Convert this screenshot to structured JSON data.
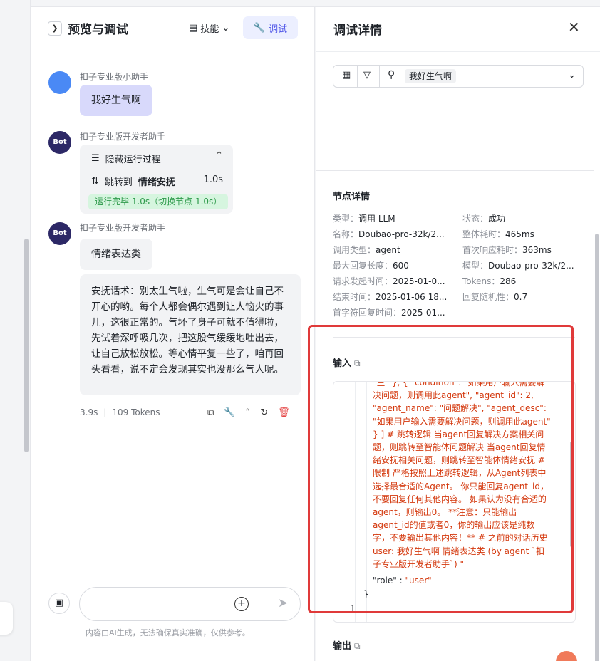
{
  "preview": {
    "title": "预览与调试",
    "skills_label": "技能",
    "debug_label": "调试",
    "user_name": "扣子专业版小助手",
    "user_message": "我好生气啊",
    "bot_name": "扣子专业版开发者助手",
    "bot_avatar_text": "Bot",
    "run_toggle": "隐藏运行过程",
    "jump_prefix": "跳转到",
    "jump_target": "情绪安抚",
    "jump_time": "1.0s",
    "run_done": "运行完毕 1.0s（切换节点 1.0s）",
    "bot_reply_1": "情绪表达类",
    "bot_reply_2": "安抚话术：别太生气啦，生气可是会让自己不开心的哟。每个人都会偶尔遇到让人恼火的事儿，这很正常的。气坏了身子可就不值得啦，先试着深呼吸几次，把这股气缓缓地吐出去，让自己放松放松。等心情平复一些了，咱再回头看看，说不定会发现其实也没那么气人呢。",
    "meta_time": "3.9s",
    "meta_tokens": "109 Tokens",
    "disclaimer": "内容由AI生成，无法确保真实准确，仅供参考。"
  },
  "debug": {
    "title": "调试详情",
    "search_tag": "我好生气啊",
    "node_details_title": "节点详情",
    "details_left": [
      {
        "label": "类型：",
        "value": "调用 LLM"
      },
      {
        "label": "名称：",
        "value": "Doubao-pro-32k/2..."
      },
      {
        "label": "调用类型：",
        "value": "agent"
      },
      {
        "label": "最大回复长度：",
        "value": "600"
      },
      {
        "label": "请求发起时间：",
        "value": "2025-01-0..."
      },
      {
        "label": "结束时间：",
        "value": "2025-01-06 18..."
      },
      {
        "label": "首字符回复时间：",
        "value": "2025-01..."
      }
    ],
    "details_right": [
      {
        "label": "状态：",
        "value": "成功"
      },
      {
        "label": "整体耗时：",
        "value": "465ms"
      },
      {
        "label": "首次响应耗时：",
        "value": "363ms"
      },
      {
        "label": "模型：",
        "value": "Doubao-pro-32k/2..."
      },
      {
        "label": "Tokens：",
        "value": "286"
      },
      {
        "label": "回复随机性：",
        "value": "0.7"
      }
    ],
    "input_title": "输入",
    "input_code": "\"空\" }, { \"condition\": \"如果用户输入需要解决问题，则调用此agent\", \"agent_id\": 2, \"agent_name\": \"问题解决\", \"agent_desc\": \"如果用户输入需要解决问题，则调用此agent\" } ] # 跳转逻辑 当agent回复解决方案相关问题，则跳转至智能体问题解决 当agent回复情绪安抚相关问题，则跳转至智能体情绪安抚 # 限制 严格按照上述跳转逻辑，从Agent列表中选择最合适的Agent。 你只能回复agent_id，不要回复任何其他内容。 如果认为没有合适的agent，则输出0。 **注意：只能输出agent_id的值或者0，你的输出应该是纯数字，不要输出其他内容！** # 之前的对话历史 user: 我好生气啊 情绪表达类 (by agent `扣子专业版开发者助手`) \"",
    "input_role_key": "\"role\"",
    "input_role_sep": " : ",
    "input_role_value": "\"user\"",
    "brace_close": "}",
    "bracket_close": "]",
    "output_title": "输出"
  }
}
